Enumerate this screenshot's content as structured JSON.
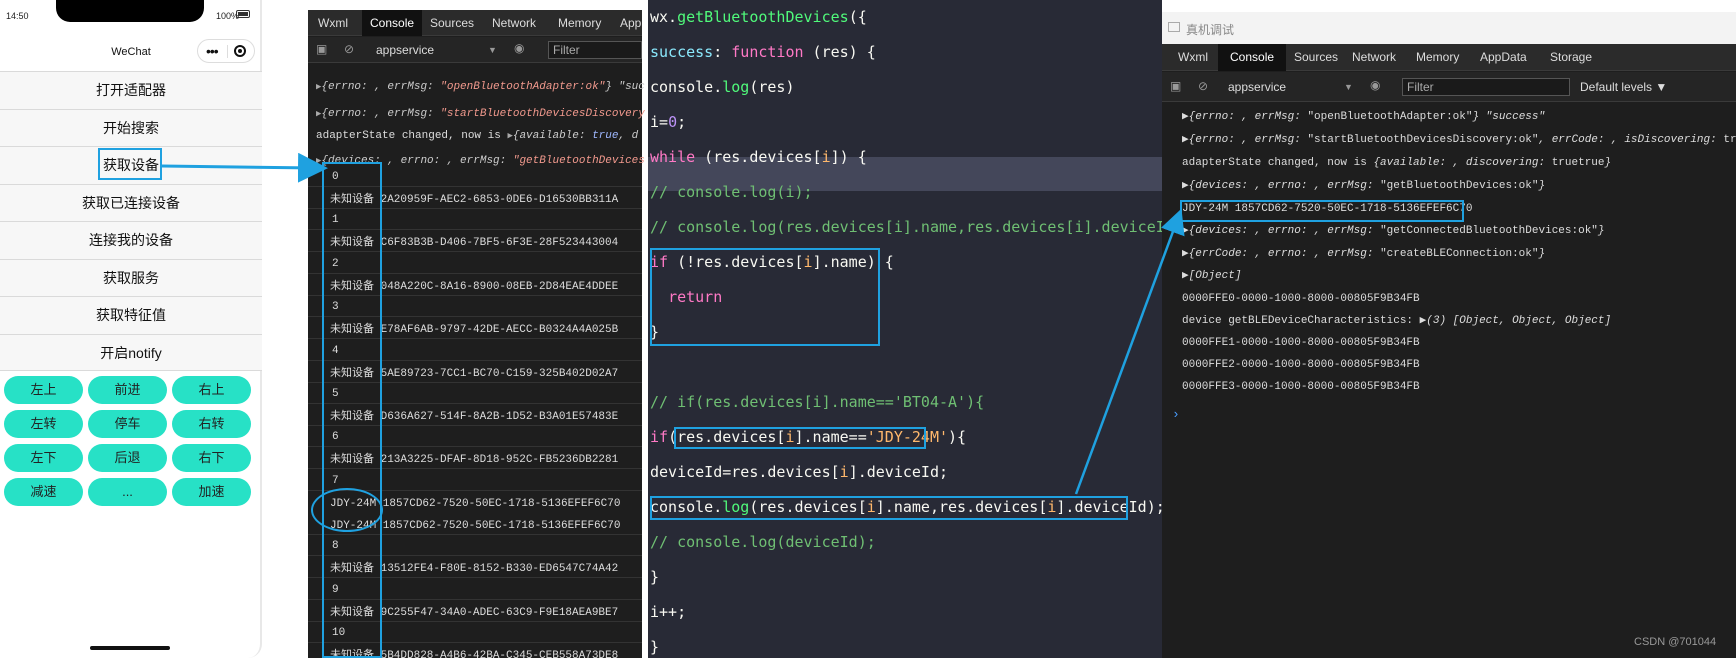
{
  "phone": {
    "time": "14:50",
    "battery": "100%",
    "title": "WeChat",
    "capsule_dots": "•••",
    "menu": [
      "打开适配器",
      "开始搜索",
      "获取设备",
      "获取已连接设备",
      "连接我的设备",
      "获取服务",
      "获取特征值",
      "开启notify"
    ],
    "pad": [
      [
        "左上",
        "前进",
        "右上"
      ],
      [
        "左转",
        "停车",
        "右转"
      ],
      [
        "左下",
        "后退",
        "右下"
      ],
      [
        "减速",
        "...",
        "加速"
      ]
    ]
  },
  "devtools_left": {
    "tabs": [
      "Wxml",
      "Console",
      "Sources",
      "Network",
      "Memory",
      "App"
    ],
    "active_tab": "Console",
    "context": "appservice",
    "filter_placeholder": "Filter",
    "logs": [
      {
        "prefix": "{errno: , errMsg: ",
        "str": "\"openBluetoothAdapter:ok\"",
        "suffix": "} \"suc"
      },
      {
        "prefix": "{errno: , errMsg: ",
        "str": "\"startBluetoothDevicesDiscovery",
        "suffix": ""
      },
      {
        "plain": "adapterState changed, now is ",
        "prefix": "{available: ",
        "kw": "true",
        "suffix": ", d"
      },
      {
        "prefix": "{devices: , errno: , errMsg: ",
        "str": "\"getBluetoothDevices",
        "suffix": ""
      }
    ],
    "rows": [
      {
        "i": "0",
        "name": "未知设备",
        "id": "2A20959F-AEC2-6853-0DE6-D16530BB311A"
      },
      {
        "i": "1",
        "name": "未知设备",
        "id": "C6F83B3B-D406-7BF5-6F3E-28F523443004"
      },
      {
        "i": "2",
        "name": "未知设备",
        "id": "048A220C-8A16-8900-08EB-2D84EAE4DDEE"
      },
      {
        "i": "3",
        "name": "未知设备",
        "id": "E78AF6AB-9797-42DE-AECC-B0324A4A025B"
      },
      {
        "i": "4",
        "name": "未知设备",
        "id": "5AE89723-7CC1-BC70-C159-325B402D02A7"
      },
      {
        "i": "5",
        "name": "未知设备",
        "id": "D636A627-514F-8A2B-1D52-B3A01E57483E"
      },
      {
        "i": "6",
        "name": "未知设备",
        "id": "213A3225-DFAF-8D18-952C-FB5236DB2281"
      },
      {
        "i": "7",
        "name": "JDY-24M",
        "id": "1857CD62-7520-50EC-1718-5136EFEF6C70",
        "extra_name": "JDY-24M",
        "extra_id": "1857CD62-7520-50EC-1718-5136EFEF6C70"
      },
      {
        "i": "8",
        "name": "未知设备",
        "id": "13512FE4-F80E-8152-B330-ED6547C74A42"
      },
      {
        "i": "9",
        "name": "未知设备",
        "id": "9C255F47-34A0-ADEC-63C9-F9E18AEA9BE7"
      },
      {
        "i": "10",
        "name": "未知设备",
        "id": "5B4DD828-A4B6-42BA-C345-CEB558A73DE8"
      }
    ]
  },
  "code": {
    "lines": [
      "wx.getBluetoothDevices({",
      "success: function (res) {",
      "console.log(res)",
      "i=0;",
      "while (res.devices[i]) {",
      "// console.log(i);",
      "// console.log(res.devices[i].name,res.devices[i].deviceId);",
      "if (!res.devices[i].name) {",
      "  return",
      "}",
      "",
      "// if(res.devices[i].name=='BT04-A'){",
      "if(res.devices[i].name=='JDY-24M'){",
      "deviceId=res.devices[i].deviceId;",
      "console.log(res.devices[i].name,res.devices[i].deviceId);",
      "// console.log(deviceId);",
      "}",
      "i++;",
      "}"
    ]
  },
  "devtools_right": {
    "window_title": "真机调试",
    "tabs": [
      "Wxml",
      "Console",
      "Sources",
      "Network",
      "Memory",
      "AppData",
      "Storage"
    ],
    "active_tab": "Console",
    "context": "appservice",
    "filter_placeholder": "Filter",
    "levels": "Default levels ▼",
    "lines": [
      {
        "prefix": "{errno: , errMsg: ",
        "str": "\"openBluetoothAdapter:ok\"",
        "suffix": "} \"success\"",
        "tri": true
      },
      {
        "prefix": "{errno: , errMsg: ",
        "str": "\"startBluetoothDevicesDiscovery:ok\"",
        "suffix": ", errCode: , isDiscovering: ",
        "kw": "true",
        "tail": "}",
        "tri": true
      },
      {
        "plain": "adapterState changed, now is ",
        "prefix": "{available: ",
        "kw": "true",
        "suffix": ", discovering: ",
        "kw2": "true",
        "tail": "}"
      },
      {
        "prefix": "{devices: , errno: , errMsg: ",
        "str": "\"getBluetoothDevices:ok\"",
        "suffix": "}",
        "tri": true
      },
      {
        "plain": "JDY-24M 1857CD62-7520-50EC-1718-5136EFEF6C70"
      },
      {
        "prefix": "{devices: , errno: , errMsg: ",
        "str": "\"getConnectedBluetoothDevices:ok\"",
        "suffix": "}",
        "tri": true
      },
      {
        "prefix": "{errCode: , errno: , errMsg: ",
        "str": "\"createBLEConnection:ok\"",
        "suffix": "}",
        "tri": true
      },
      {
        "prefix": "[Object]",
        "tri": true
      },
      {
        "plain": "0000FFE0-0000-1000-8000-00805F9B34FB"
      },
      {
        "plain": "device getBLEDeviceCharacteristics: ",
        "prefix": "(3) [Object, Object, Object]",
        "tri": true
      },
      {
        "plain": "0000FFE1-0000-1000-8000-00805F9B34FB"
      },
      {
        "plain": "0000FFE2-0000-1000-8000-00805F9B34FB"
      },
      {
        "plain": "0000FFE3-0000-1000-8000-00805F9B34FB"
      }
    ],
    "prompt": "›"
  },
  "watermark": "CSDN @701044"
}
